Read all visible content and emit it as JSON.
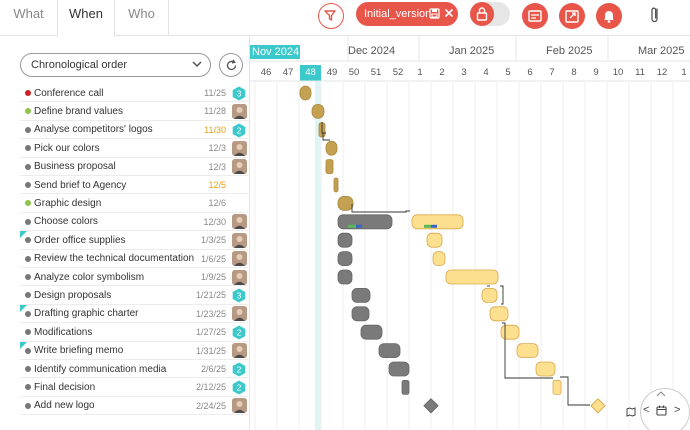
{
  "tabs": [
    {
      "label": "What",
      "active": false
    },
    {
      "label": "When",
      "active": true
    },
    {
      "label": "Who",
      "active": false
    }
  ],
  "toolbar": {
    "version_label": "Initial_version",
    "accent_color": "#e8564a"
  },
  "left": {
    "sort_value": "Chronological order"
  },
  "tasks": [
    {
      "name": "Conference call",
      "date": "11/25",
      "dot": "#cc2222",
      "date_color": "gray",
      "marker": {
        "type": "badge",
        "value": "3"
      }
    },
    {
      "name": "Define brand values",
      "date": "11/28",
      "dot": "#8dc34a",
      "date_color": "gray",
      "marker": {
        "type": "avatar"
      }
    },
    {
      "name": "Analyse competitors' logos",
      "date": "11/30",
      "dot": "#777777",
      "date_color": "orange",
      "marker": {
        "type": "badge",
        "value": "2"
      }
    },
    {
      "name": "Pick our colors",
      "date": "12/3",
      "dot": "#777777",
      "date_color": "gray",
      "marker": {
        "type": "avatar"
      }
    },
    {
      "name": "Business proposal",
      "date": "12/3",
      "dot": "#777777",
      "date_color": "gray",
      "marker": {
        "type": "avatar"
      }
    },
    {
      "name": "Send brief to Agency",
      "date": "12/5",
      "dot": "#777777",
      "date_color": "orange",
      "marker": {
        "type": "none"
      }
    },
    {
      "name": "Graphic design",
      "date": "12/6",
      "dot": "#8dc34a",
      "date_color": "gray",
      "marker": {
        "type": "none"
      }
    },
    {
      "name": "Choose colors",
      "date": "12/30",
      "dot": "#777777",
      "date_color": "gray",
      "marker": {
        "type": "avatar"
      }
    },
    {
      "name": "Order office supplies",
      "date": "1/3/25",
      "dot": "#777777",
      "date_color": "gray",
      "marker": {
        "type": "avatar"
      },
      "flag": true
    },
    {
      "name": "Review the technical documentation",
      "date": "1/6/25",
      "dot": "#777777",
      "date_color": "gray",
      "marker": {
        "type": "avatar"
      }
    },
    {
      "name": "Analyze color symbolism",
      "date": "1/9/25",
      "dot": "#777777",
      "date_color": "gray",
      "marker": {
        "type": "avatar"
      }
    },
    {
      "name": "Design proposals",
      "date": "1/21/25",
      "dot": "#777777",
      "date_color": "gray",
      "marker": {
        "type": "badge",
        "value": "3"
      }
    },
    {
      "name": "Drafting graphic charter",
      "date": "1/23/25",
      "dot": "#777777",
      "date_color": "gray",
      "marker": {
        "type": "avatar"
      },
      "flag": true
    },
    {
      "name": "Modifications",
      "date": "1/27/25",
      "dot": "#777777",
      "date_color": "gray",
      "marker": {
        "type": "badge",
        "value": "2"
      }
    },
    {
      "name": "Write briefing memo",
      "date": "1/31/25",
      "dot": "#777777",
      "date_color": "gray",
      "marker": {
        "type": "avatar"
      },
      "flag": true
    },
    {
      "name": "Identify communication media",
      "date": "2/6/25",
      "dot": "#777777",
      "date_color": "gray",
      "marker": {
        "type": "badge",
        "value": "2"
      }
    },
    {
      "name": "Final decision",
      "date": "2/12/25",
      "dot": "#777777",
      "date_color": "gray",
      "marker": {
        "type": "badge",
        "value": "2"
      }
    },
    {
      "name": "Add new logo",
      "date": "2/24/25",
      "dot": "#777777",
      "date_color": "gray",
      "marker": {
        "type": "avatar"
      }
    }
  ],
  "timeline": {
    "months": [
      {
        "label": "Nov 2024",
        "current": true
      },
      {
        "label": "Dec 2024",
        "current": false
      },
      {
        "label": "Jan 2025",
        "current": false
      },
      {
        "label": "Feb 2025",
        "current": false
      },
      {
        "label": "Mar 2025",
        "current": false
      }
    ],
    "weeks": [
      "46",
      "47",
      "48",
      "49",
      "50",
      "51",
      "52",
      "1",
      "2",
      "3",
      "4",
      "5",
      "6",
      "7",
      "8",
      "9",
      "10",
      "11",
      "12",
      "1"
    ],
    "current_week": "48",
    "colors": {
      "current": "#3cc9cb",
      "done": "#c4a052",
      "grey": "#7a7a7a",
      "planned": "#fde08f"
    }
  },
  "nav": {
    "prev": "<",
    "next": ">"
  }
}
